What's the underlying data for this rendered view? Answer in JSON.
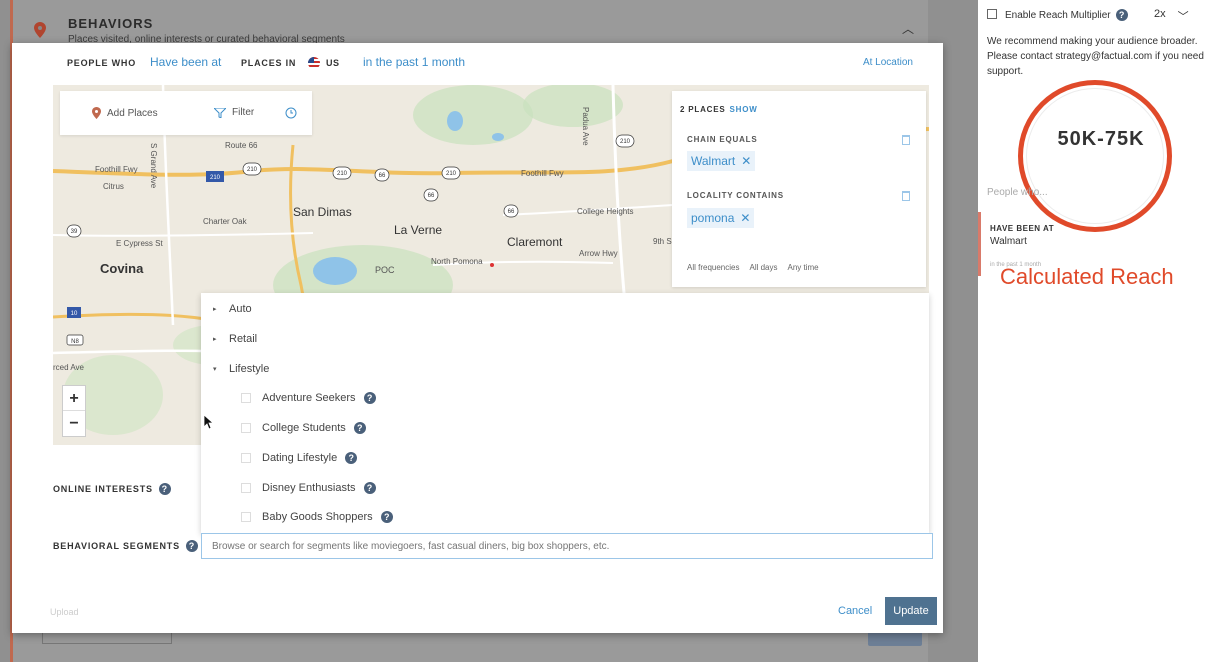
{
  "background": {
    "section_title": "BEHAVIORS",
    "section_subtitle": "Places visited, online interests or curated behavioral segments"
  },
  "header": {
    "people_who_label": "PEOPLE WHO",
    "action_value": "Have been at",
    "places_in_label": "PLACES IN",
    "country": "US",
    "time_range": "in the past 1 month",
    "at_location": "At Location"
  },
  "map_toolbar": {
    "add_places": "Add Places",
    "filter": "Filter"
  },
  "map": {
    "cities": [
      "San Dimas",
      "La Verne",
      "Claremont",
      "Covina"
    ],
    "labels": [
      "Route 66",
      "Foothill Fwy",
      "Citrus",
      "Charter Oak",
      "E Cypress St",
      "College Heights",
      "Arrow Hwy",
      "North Pomona",
      "Foothill Fwy",
      "POC",
      "rced Ave",
      "S Grand Ave",
      "Padua Ave",
      "9th S"
    ],
    "shields": [
      "210",
      "210",
      "210",
      "66",
      "66",
      "66",
      "210",
      "39",
      "210",
      "83",
      "10"
    ]
  },
  "places_panel": {
    "count_label": "2 PLACES",
    "show": "SHOW",
    "cond1_label": "CHAIN EQUALS",
    "cond1_value": "Walmart",
    "cond2_label": "LOCALITY CONTAINS",
    "cond2_value": "pomona",
    "footer": [
      "All frequencies",
      "All days",
      "Any time"
    ]
  },
  "zoom": {
    "plus": "+",
    "minus": "−"
  },
  "dropdown": {
    "categories": [
      {
        "label": "Auto",
        "arrow": "▸"
      },
      {
        "label": "Retail",
        "arrow": "▸"
      },
      {
        "label": "Lifestyle",
        "arrow": "▾"
      }
    ],
    "items": [
      "Adventure Seekers",
      "College Students",
      "Dating Lifestyle",
      "Disney Enthusiasts",
      "Baby Goods Shoppers"
    ]
  },
  "online_interests_label": "ONLINE INTERESTS",
  "behavioral_segments_label": "BEHAVIORAL SEGMENTS",
  "segments_placeholder": "Browse or search for segments like moviegoers, fast casual diners, big box shoppers, etc.",
  "footer": {
    "upload": "Upload",
    "cancel": "Cancel",
    "update": "Update"
  },
  "right_panel": {
    "reach_multiplier_label": "Enable Reach Multiplier",
    "multiplier_value": "2x",
    "note": "We recommend making your audience broader. Please contact strategy@factual.com if you need support.",
    "reach_value": "50K-75K",
    "people_who": "People who...",
    "have_been_at_label": "HAVE BEEN AT",
    "have_been_at_value": "Walmart",
    "time_small": "in the past 1 month",
    "calculated_reach": "Calculated Reach"
  },
  "colors": {
    "accent_blue": "#3d8ec9",
    "update_button": "#4f7290",
    "reach_red": "#e04a2a"
  }
}
